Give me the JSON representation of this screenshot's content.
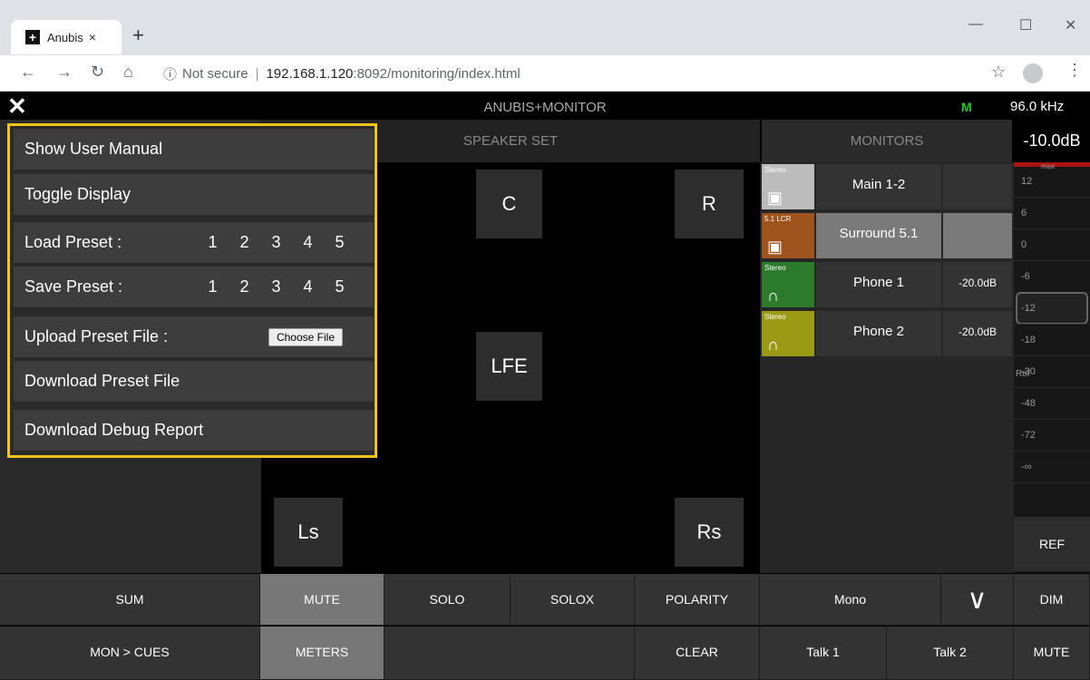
{
  "browser": {
    "tab_title": "Anubis",
    "tab_close": "×",
    "new_tab": "+",
    "url_warning": "Not secure",
    "url_host": "192.168.1.120",
    "url_rest": ":8092/monitoring/index.html",
    "win_min": "—",
    "win_max": "☐",
    "win_close": "✕"
  },
  "app": {
    "close": "✕",
    "title": "ANUBIS+MONITOR",
    "mode": "M",
    "sample_rate": "96.0 kHz",
    "speaker_set_header": "SPEAKER SET",
    "monitors_header": "MONITORS",
    "level_readout": "-10.0dB"
  },
  "speakers": {
    "c": "C",
    "r": "R",
    "lfe": "LFE",
    "ls": "Ls",
    "rs": "Rs"
  },
  "monitors": [
    {
      "format": "Stereo",
      "name": "Main 1-2",
      "level": "",
      "color": "#bcbcbc",
      "icon": "speaker-icon",
      "selected": false
    },
    {
      "format": "5.1 LCR",
      "name": "Surround 5.1",
      "level": "",
      "color": "#a0541d",
      "icon": "speaker-icon",
      "selected": true
    },
    {
      "format": "Stereo",
      "name": "Phone 1",
      "level": "-20.0dB",
      "color": "#2c7a2c",
      "icon": "headphones-icon",
      "selected": false
    },
    {
      "format": "Stereo",
      "name": "Phone 2",
      "level": "-20.0dB",
      "color": "#9a9a14",
      "icon": "headphones-icon",
      "selected": false
    }
  ],
  "meter": {
    "max_label": "max",
    "ticks": [
      "12",
      "6",
      "0",
      "-6",
      "-12",
      "-18",
      "-30",
      "-48",
      "-72",
      "-∞"
    ],
    "ref_label": "Ref",
    "ref_button": "REF"
  },
  "bottom_row1": {
    "sum": "SUM",
    "mute": "MUTE",
    "solo": "SOLO",
    "solox": "SOLOX",
    "polarity": "POLARITY",
    "mono": "Mono",
    "dim": "DIM"
  },
  "bottom_row2": {
    "mon_cues": "MON > CUES",
    "meters": "METERS",
    "clear": "CLEAR",
    "talk1": "Talk 1",
    "talk2": "Talk 2",
    "mute": "MUTE"
  },
  "menu": {
    "show_manual": "Show User Manual",
    "toggle_display": "Toggle Display",
    "load_preset": "Load Preset :",
    "save_preset": "Save Preset :",
    "preset_numbers": [
      "1",
      "2",
      "3",
      "4",
      "5"
    ],
    "upload_preset": "Upload Preset File :",
    "choose_file": "Choose File",
    "download_preset": "Download Preset File",
    "download_debug": "Download Debug Report"
  }
}
